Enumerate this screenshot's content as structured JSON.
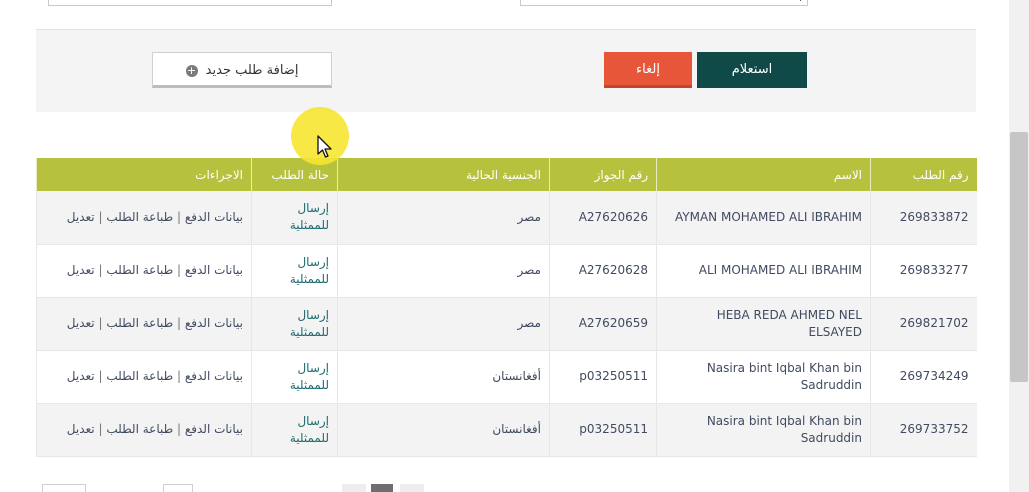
{
  "buttons": {
    "add_new": "إضافة طلب جديد",
    "cancel": "إلغاء",
    "search": "استعلام"
  },
  "table": {
    "headers": {
      "request_no": "رقم الطلب",
      "name": "الاسم",
      "passport_no": "رقم الجواز",
      "nationality": "الجنسية الحالية",
      "status": "حالة الطلب",
      "actions": "الاجراءات"
    },
    "action_labels": {
      "payment": "بيانات الدفع",
      "print": "طباعة الطلب",
      "edit": "تعديل",
      "separator": "|"
    },
    "rows": [
      {
        "request_no": "269833872",
        "name": "AYMAN MOHAMED ALI IBRAHIM",
        "passport_no": "A27620626",
        "nationality": "مصر",
        "status": "إرسال للممثلية"
      },
      {
        "request_no": "269833277",
        "name": "ALI MOHAMED ALI IBRAHIM",
        "passport_no": "A27620628",
        "nationality": "مصر",
        "status": "إرسال للممثلية"
      },
      {
        "request_no": "269821702",
        "name": "HEBA REDA AHMED NEL ELSAYED",
        "passport_no": "A27620659",
        "nationality": "مصر",
        "status": "إرسال للممثلية"
      },
      {
        "request_no": "269734249",
        "name": "Nasira bint Iqbal Khan bin Sadruddin",
        "passport_no": "p03250511",
        "nationality": "أفغانستان",
        "status": "إرسال للممثلية"
      },
      {
        "request_no": "269733752",
        "name": "Nasira bint Iqbal Khan bin Sadruddin",
        "passport_no": "p03250511",
        "nationality": "أفغانستان",
        "status": "إرسال للممثلية"
      }
    ]
  },
  "colors": {
    "header_green": "#b6c23e",
    "search_button": "#0f4a48",
    "cancel_button": "#e8563a",
    "status_text": "#1d6b6f"
  }
}
